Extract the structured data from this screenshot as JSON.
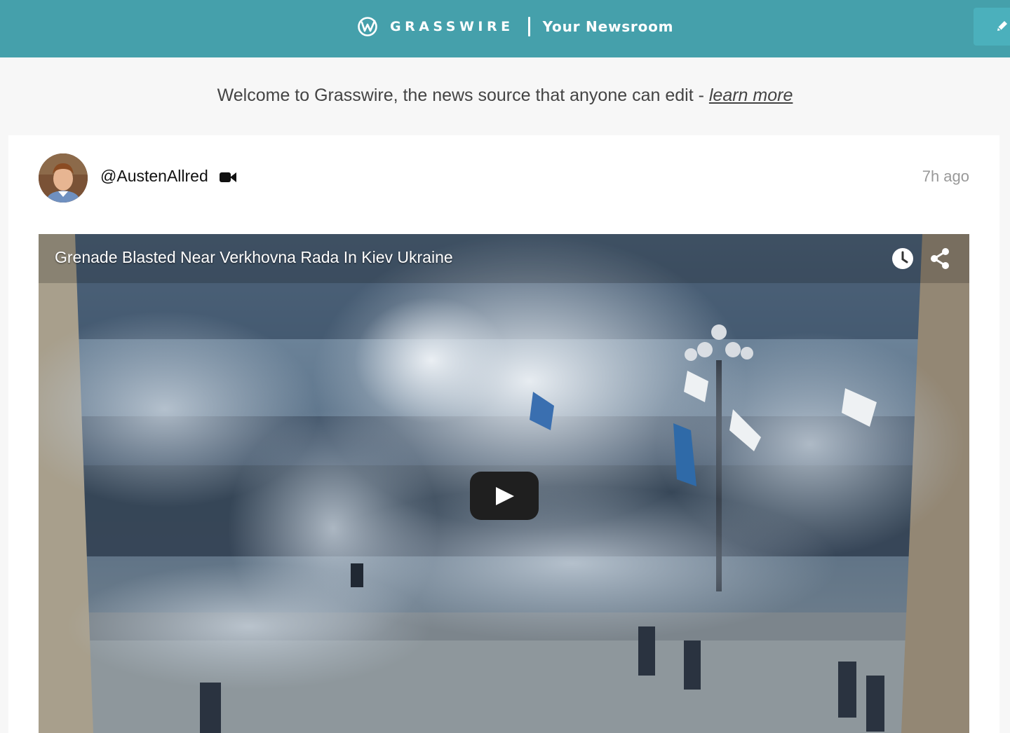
{
  "header": {
    "brand": "GRASSWIRE",
    "section": "Your Newsroom"
  },
  "banner": {
    "text": "Welcome to Grasswire, the news source that anyone can edit - ",
    "link": "learn more"
  },
  "post": {
    "handle": "@AustenAllred",
    "media_type_icon": "video-camera-icon",
    "time": "7h ago",
    "video": {
      "title": "Grenade Blasted Near Verkhovna Rada In Kiev Ukraine",
      "icons": [
        "clock-icon",
        "share-icon",
        "play-icon"
      ]
    }
  },
  "colors": {
    "header_bg": "#45a0ab",
    "page_bg": "#f7f7f7",
    "card_bg": "#ffffff",
    "play_button": "#1f1f1f"
  }
}
